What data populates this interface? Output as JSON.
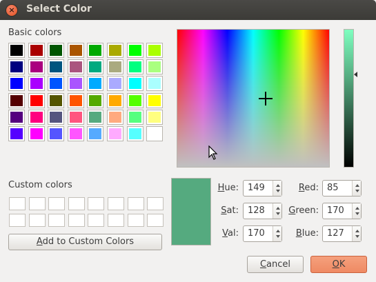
{
  "window": {
    "title": "Select Color",
    "close_glyph": "×"
  },
  "basic_colors": {
    "label": "Basic colors",
    "rows": [
      [
        "#000000",
        "#aa0000",
        "#005500",
        "#aa5500",
        "#00aa00",
        "#aaaa00",
        "#00ff00",
        "#aaff00"
      ],
      [
        "#00007f",
        "#aa007f",
        "#00557f",
        "#aa557f",
        "#00aa7f",
        "#aaaa7f",
        "#00ff7f",
        "#aaff7f"
      ],
      [
        "#0000ff",
        "#aa00ff",
        "#0055ff",
        "#aa55ff",
        "#00aaff",
        "#aaaaff",
        "#00ffff",
        "#aaffff"
      ],
      [
        "#550000",
        "#ff0000",
        "#555500",
        "#ff5500",
        "#55aa00",
        "#ffaa00",
        "#55ff00",
        "#ffff00"
      ],
      [
        "#55007f",
        "#ff007f",
        "#55557f",
        "#ff557f",
        "#55aa7f",
        "#ffaa7f",
        "#55ff7f",
        "#ffff7f"
      ],
      [
        "#5500ff",
        "#ff00ff",
        "#5555ff",
        "#ff55ff",
        "#55aaff",
        "#ffaaff",
        "#55ffff",
        "#ffffff"
      ]
    ]
  },
  "custom_colors": {
    "label": "Custom colors",
    "count": 16
  },
  "add_button": {
    "underlined": "A",
    "rest": "dd to Custom Colors"
  },
  "current_color": "#55aa7f",
  "hue": {
    "underlined": "H",
    "rest": "ue:",
    "value": "149"
  },
  "sat": {
    "underlined": "S",
    "rest": "at:",
    "value": "128"
  },
  "val": {
    "underlined": "V",
    "rest": "al:",
    "value": "170"
  },
  "red": {
    "underlined": "R",
    "rest": "ed:",
    "value": "85"
  },
  "green": {
    "underlined": "G",
    "rest": "reen:",
    "value": "170"
  },
  "blue": {
    "underlined": "B",
    "rest": "lue:",
    "value": "127"
  },
  "cancel_button": {
    "underlined": "C",
    "rest": "ancel"
  },
  "ok_button": {
    "underlined": "O",
    "rest": "K"
  }
}
